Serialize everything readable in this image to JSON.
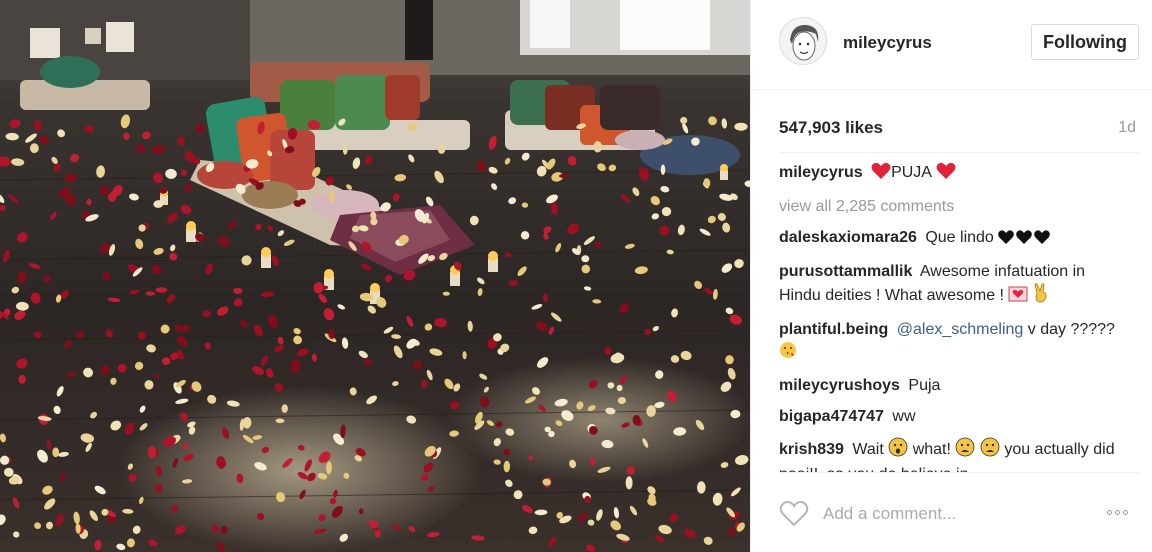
{
  "post": {
    "username": "mileycyrus",
    "follow_label": "Following",
    "likes": "547,903 likes",
    "age": "1d",
    "caption": {
      "user": "mileycyrus",
      "text": "PUJA"
    },
    "view_all": "view all 2,285 comments",
    "comments": [
      {
        "user": "daleskaxiomara26",
        "text": "Que lindo"
      },
      {
        "user": "purusottammallik",
        "text": "Awesome infatuation in Hindu deities ! What awesome !"
      },
      {
        "user": "plantiful.being",
        "mention": "@alex_schmeling",
        "text": "v day ?????"
      },
      {
        "user": "mileycyrushoys",
        "text": "Puja"
      },
      {
        "user": "bigapa474747",
        "text": "ww"
      },
      {
        "user": "krish839",
        "text_a": "Wait",
        "text_b": "what!",
        "text_c": "you actually did pooj!!, so you do believe in"
      }
    ],
    "comment_placeholder": "Add a comment..."
  },
  "icons": {
    "heart": "heart-outline-icon",
    "more": "ellipsis-icon",
    "red_heart": "red-heart-emoji",
    "black_heart": "black-heart-emoji"
  },
  "colors": {
    "red_heart": "#e0223a",
    "mention": "#3b5f8a",
    "muted": "#999999"
  }
}
